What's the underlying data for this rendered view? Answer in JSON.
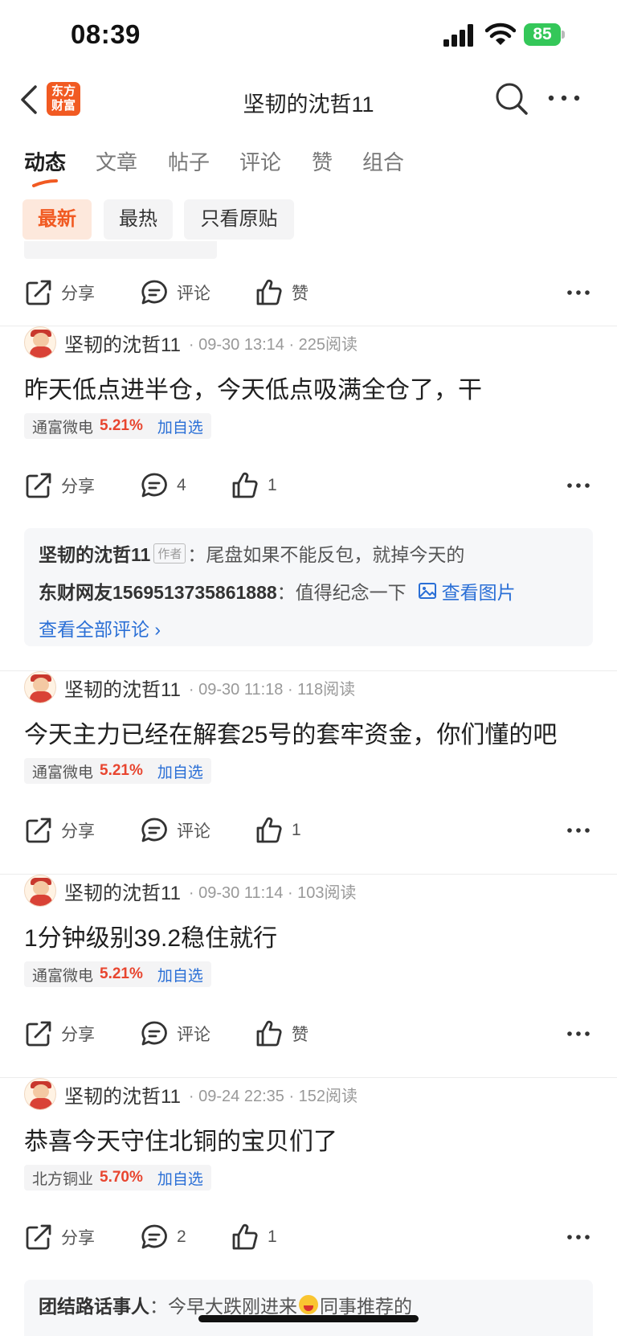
{
  "status_bar": {
    "time": "08:39",
    "battery": "85"
  },
  "nav": {
    "title": "坚韧的沈哲11",
    "logo_text": "东方财富"
  },
  "tabs": [
    {
      "label": "动态"
    },
    {
      "label": "文章"
    },
    {
      "label": "帖子"
    },
    {
      "label": "评论"
    },
    {
      "label": "赞"
    },
    {
      "label": "组合"
    }
  ],
  "filters": [
    {
      "label": "最新"
    },
    {
      "label": "最热"
    },
    {
      "label": "只看原贴"
    }
  ],
  "colors": {
    "accent": "#f15a22",
    "up": "#e8452f",
    "link": "#2a6fd6"
  },
  "actions_top": {
    "share": "分享",
    "comment": "评论",
    "like": "赞"
  },
  "posts": [
    {
      "author": "坚韧的沈哲11",
      "meta": "· 09-30 13:14 · 225阅读",
      "text": "昨天低点进半仓，今天低点吸满全仓了，干",
      "stock": {
        "name": "通富微电",
        "change": "5.21%",
        "add": "加自选"
      },
      "share": "分享",
      "comment": "4",
      "like": "1",
      "comments": [
        {
          "user": "坚韧的沈哲11",
          "badge": "作者",
          "sep": "：",
          "text": "尾盘如果不能反包，就掉今天的"
        },
        {
          "user": "东财网友1569513735861888",
          "sep": "：",
          "text": "值得纪念一下",
          "image_link": "查看图片"
        }
      ],
      "view_all": "查看全部评论 ›"
    },
    {
      "author": "坚韧的沈哲11",
      "meta": "· 09-30 11:18 · 118阅读",
      "text": "今天主力已经在解套25号的套牢资金，你们懂的吧",
      "stock": {
        "name": "通富微电",
        "change": "5.21%",
        "add": "加自选"
      },
      "share": "分享",
      "comment": "评论",
      "like": "1"
    },
    {
      "author": "坚韧的沈哲11",
      "meta": "· 09-30 11:14 · 103阅读",
      "text": "1分钟级别39.2稳住就行",
      "stock": {
        "name": "通富微电",
        "change": "5.21%",
        "add": "加自选"
      },
      "share": "分享",
      "comment": "评论",
      "like": "赞"
    },
    {
      "author": "坚韧的沈哲11",
      "meta": "· 09-24 22:35 · 152阅读",
      "text": "恭喜今天守住北铜的宝贝们了",
      "stock": {
        "name": "北方铜业",
        "change": "5.70%",
        "add": "加自选"
      },
      "share": "分享",
      "comment": "2",
      "like": "1",
      "comments": [
        {
          "user": "团结路话事人",
          "sep": "：",
          "text_before": "今早大跌刚进来",
          "text_after": "同事推荐的"
        }
      ]
    }
  ]
}
